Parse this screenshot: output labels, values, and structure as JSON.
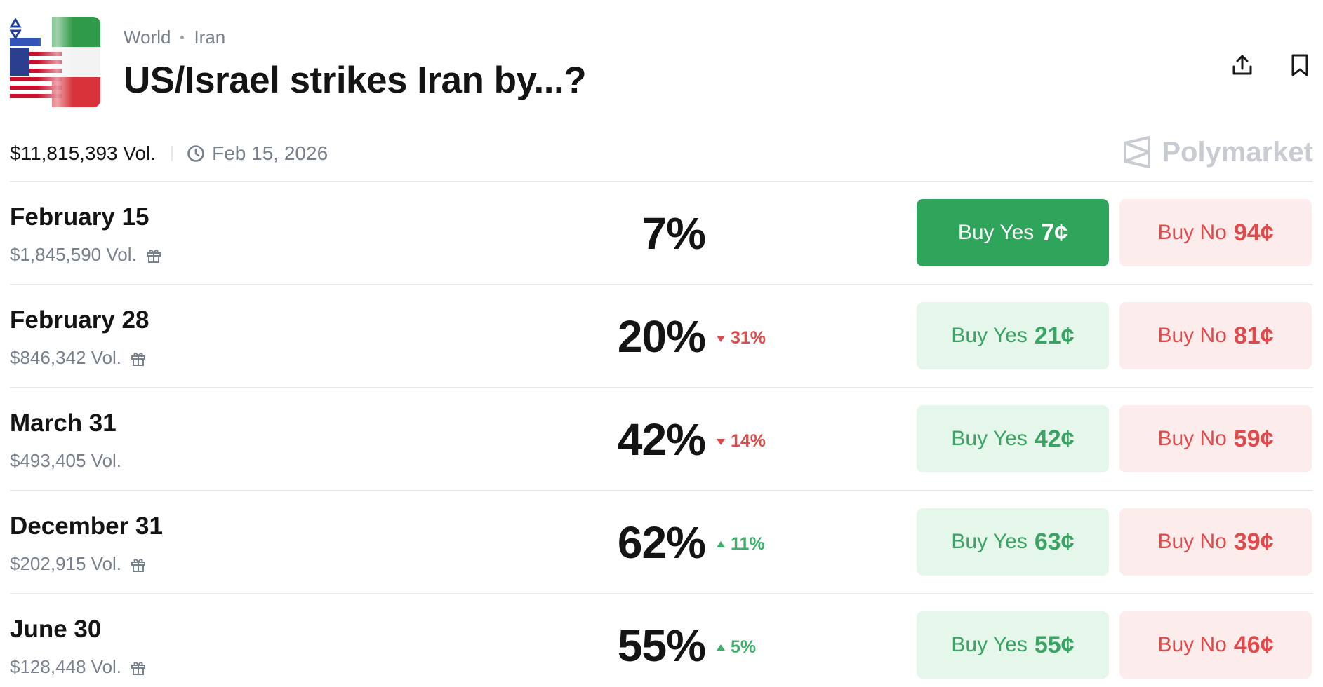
{
  "header": {
    "breadcrumbs": [
      "World",
      "Iran"
    ],
    "title": "US/Israel strikes Iran by...?"
  },
  "meta": {
    "volume": "$11,815,393 Vol.",
    "date": "Feb 15, 2026",
    "brand": "Polymarket"
  },
  "outcomes": [
    {
      "label": "February 15",
      "volume": "$1,845,590 Vol.",
      "gift": true,
      "probability": "7%",
      "delta": "",
      "direction": "",
      "yes_text": "Buy Yes",
      "yes_price": "7¢",
      "no_text": "Buy No",
      "no_price": "94¢",
      "yes_active": true
    },
    {
      "label": "February 28",
      "volume": "$846,342 Vol.",
      "gift": true,
      "probability": "20%",
      "delta": "31%",
      "direction": "down",
      "yes_text": "Buy Yes",
      "yes_price": "21¢",
      "no_text": "Buy No",
      "no_price": "81¢",
      "yes_active": false
    },
    {
      "label": "March 31",
      "volume": "$493,405 Vol.",
      "gift": false,
      "probability": "42%",
      "delta": "14%",
      "direction": "down",
      "yes_text": "Buy Yes",
      "yes_price": "42¢",
      "no_text": "Buy No",
      "no_price": "59¢",
      "yes_active": false
    },
    {
      "label": "December 31",
      "volume": "$202,915 Vol.",
      "gift": true,
      "probability": "62%",
      "delta": "11%",
      "direction": "up",
      "yes_text": "Buy Yes",
      "yes_price": "63¢",
      "no_text": "Buy No",
      "no_price": "39¢",
      "yes_active": false
    },
    {
      "label": "June 30",
      "volume": "$128,448 Vol.",
      "gift": true,
      "probability": "55%",
      "delta": "5%",
      "direction": "up",
      "yes_text": "Buy Yes",
      "yes_price": "55¢",
      "no_text": "Buy No",
      "no_price": "46¢",
      "yes_active": false
    }
  ],
  "icons": {
    "share": "share-icon",
    "bookmark": "bookmark-icon",
    "clock": "clock-icon",
    "gift": "gift-icon",
    "brand_logo": "polymarket-logo-icon"
  },
  "colors": {
    "yes_active": "#2fa45b",
    "yes_bg": "#e5f7ea",
    "yes_text": "#3ba364",
    "no_bg": "#fcecec",
    "no_text": "#e04a4a",
    "up": "#3db06a",
    "down": "#e04a4a"
  }
}
